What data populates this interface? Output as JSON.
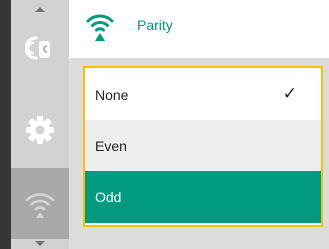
{
  "header": {
    "title": "Parity",
    "icon": "wireless-signal-icon"
  },
  "sidebar": {
    "items": [
      {
        "icon": "remote-control-icon",
        "active": false
      },
      {
        "icon": "gear-icon",
        "active": false
      },
      {
        "icon": "wireless-signal-icon",
        "active": true
      }
    ]
  },
  "options": [
    {
      "label": "None",
      "checked": true,
      "check_mark": "✓",
      "highlighted": false
    },
    {
      "label": "Even",
      "checked": false,
      "highlighted": false
    },
    {
      "label": "Odd",
      "checked": false,
      "highlighted": true
    }
  ],
  "colors": {
    "accent": "#009a7f",
    "focus_border": "#f2c400",
    "sidebar": "#d2d2d2"
  }
}
